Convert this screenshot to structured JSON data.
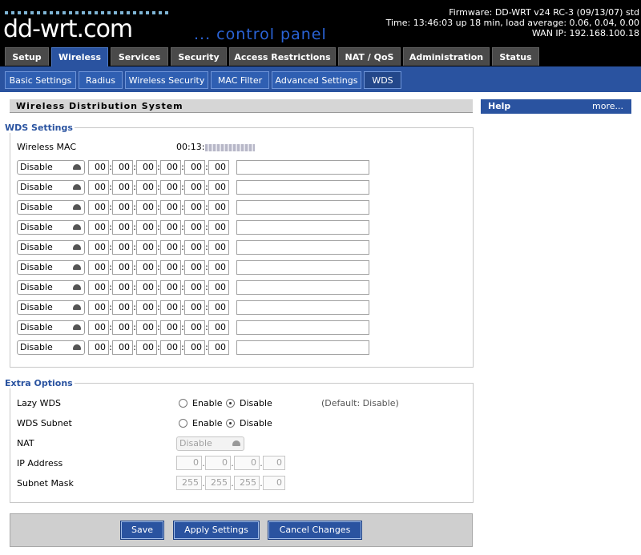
{
  "header": {
    "logo": "dd-wrt.com",
    "tagline": "... control panel",
    "firmware": "Firmware: DD-WRT v24 RC-3 (09/13/07) std",
    "time": "Time: 13:46:03 up 18 min, load average: 0.06, 0.04, 0.00",
    "wan_ip": "WAN IP: 192.168.100.18"
  },
  "main_tabs": [
    "Setup",
    "Wireless",
    "Services",
    "Security",
    "Access Restrictions",
    "NAT / QoS",
    "Administration",
    "Status"
  ],
  "sub_tabs": [
    "Basic Settings",
    "Radius",
    "Wireless Security",
    "MAC Filter",
    "Advanced Settings",
    "WDS"
  ],
  "page_title": "Wireless Distribution System",
  "help": {
    "title": "Help",
    "more": "more..."
  },
  "wds": {
    "legend": "WDS Settings",
    "mac_label": "Wireless MAC",
    "mac_value": "00:13:",
    "rows": [
      {
        "mode": "Disable",
        "octets": [
          "00",
          "00",
          "00",
          "00",
          "00",
          "00"
        ],
        "description": ""
      },
      {
        "mode": "Disable",
        "octets": [
          "00",
          "00",
          "00",
          "00",
          "00",
          "00"
        ],
        "description": ""
      },
      {
        "mode": "Disable",
        "octets": [
          "00",
          "00",
          "00",
          "00",
          "00",
          "00"
        ],
        "description": ""
      },
      {
        "mode": "Disable",
        "octets": [
          "00",
          "00",
          "00",
          "00",
          "00",
          "00"
        ],
        "description": ""
      },
      {
        "mode": "Disable",
        "octets": [
          "00",
          "00",
          "00",
          "00",
          "00",
          "00"
        ],
        "description": ""
      },
      {
        "mode": "Disable",
        "octets": [
          "00",
          "00",
          "00",
          "00",
          "00",
          "00"
        ],
        "description": ""
      },
      {
        "mode": "Disable",
        "octets": [
          "00",
          "00",
          "00",
          "00",
          "00",
          "00"
        ],
        "description": ""
      },
      {
        "mode": "Disable",
        "octets": [
          "00",
          "00",
          "00",
          "00",
          "00",
          "00"
        ],
        "description": ""
      },
      {
        "mode": "Disable",
        "octets": [
          "00",
          "00",
          "00",
          "00",
          "00",
          "00"
        ],
        "description": ""
      },
      {
        "mode": "Disable",
        "octets": [
          "00",
          "00",
          "00",
          "00",
          "00",
          "00"
        ],
        "description": ""
      }
    ]
  },
  "extra": {
    "legend": "Extra Options",
    "lazy_wds": {
      "label": "Lazy WDS",
      "enable": "Enable",
      "disable": "Disable",
      "selected": "Disable",
      "default_note": "(Default: Disable)"
    },
    "wds_subnet": {
      "label": "WDS Subnet",
      "enable": "Enable",
      "disable": "Disable",
      "selected": "Disable"
    },
    "nat": {
      "label": "NAT",
      "value": "Disable"
    },
    "ip_address": {
      "label": "IP Address",
      "octets": [
        "0",
        "0",
        "0",
        "0"
      ]
    },
    "subnet_mask": {
      "label": "Subnet Mask",
      "octets": [
        "255",
        "255",
        "255",
        "0"
      ]
    }
  },
  "buttons": {
    "save": "Save",
    "apply": "Apply Settings",
    "cancel": "Cancel Changes"
  }
}
